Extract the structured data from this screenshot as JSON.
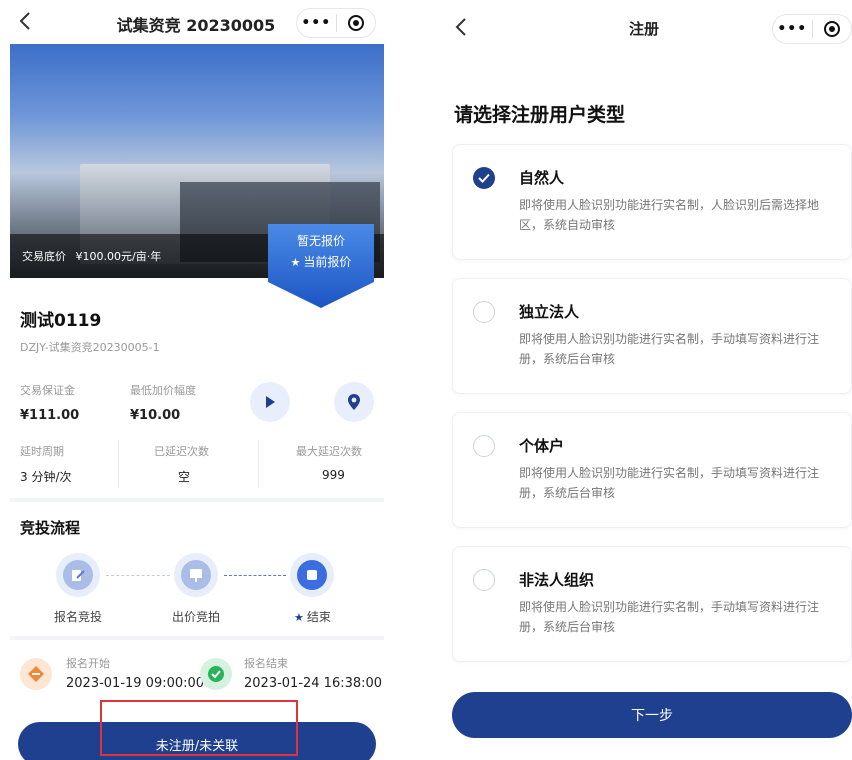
{
  "left": {
    "nav": {
      "title": "试集资竞 20230005",
      "more": "•••"
    },
    "hero": {
      "base_price_label": "交易底价",
      "base_price_value": "¥100.00元/亩·年",
      "badge_line1": "暂无报价",
      "badge_line2": "当前报价"
    },
    "lot": {
      "title": "测试0119",
      "code": "DZJY-试集资竞20230005-1"
    },
    "info": {
      "deposit_label": "交易保证金",
      "deposit_value": "¥111.00",
      "increment_label": "最低加价幅度",
      "increment_value": "¥10.00",
      "delay_period_label": "延时周期",
      "delay_period_value": "3 分钟/次",
      "delayed_count_label": "已延迟次数",
      "delayed_count_value": "空",
      "max_delay_label": "最大延迟次数",
      "max_delay_value": "999"
    },
    "process": {
      "title": "竞投流程",
      "steps": [
        {
          "label": "报名竞投"
        },
        {
          "label": "出价竞拍"
        },
        {
          "label": "结束"
        }
      ]
    },
    "times": {
      "start_label": "报名开始",
      "start_value": "2023-01-19 09:00:00",
      "end_label": "报名结束",
      "end_value": "2023-01-24 16:38:00"
    },
    "cta_label": "未注册/未关联"
  },
  "right": {
    "nav": {
      "title": "注册",
      "more": "•••"
    },
    "heading": "请选择注册用户类型",
    "options": [
      {
        "name": "自然人",
        "desc": "即将使用人脸识别功能进行实名制，人脸识别后需选择地区，系统自动审核",
        "selected": true
      },
      {
        "name": "独立法人",
        "desc": "即将使用人脸识别功能进行实名制，手动填写资料进行注册，系统后台审核",
        "selected": false
      },
      {
        "name": "个体户",
        "desc": "即将使用人脸识别功能进行实名制，手动填写资料进行注册，系统后台审核",
        "selected": false
      },
      {
        "name": "非法人组织",
        "desc": "即将使用人脸识别功能进行实名制，手动填写资料进行注册，系统后台审核",
        "selected": false
      }
    ],
    "next_label": "下一步"
  },
  "colors": {
    "primary": "#1f3f8f",
    "badge_blue": "#2f6fd6",
    "highlight_red": "#e0333b",
    "orange": "#f0883a",
    "green": "#27b35a"
  }
}
